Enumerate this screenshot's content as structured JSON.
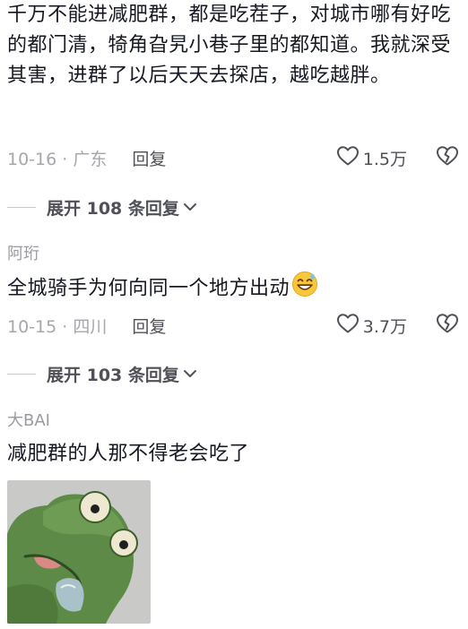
{
  "comments": [
    {
      "username": "",
      "content": "千万不能进减肥群，都是吃茬子，对城市哪有好吃的都门清，犄角旮旯小巷子里的都知道。我就深受其害，进群了以后天天去探店，越吃越胖。",
      "date_location": "10-16 · 广东",
      "reply_label": "回复",
      "like_count": "1.5万",
      "expand_label": "展开 108 条回复"
    },
    {
      "username": "阿珩",
      "content": "全城骑手为何向同一个地方出动",
      "emoji": "grinning-sweat-emoji",
      "date_location": "10-15 · 四川",
      "reply_label": "回复",
      "like_count": "3.7万",
      "expand_label": "展开 103 条回复"
    },
    {
      "username": "大BAI",
      "content": "减肥群的人那不得老会吃了",
      "image": "frog-sticker"
    }
  ],
  "icons": {
    "like": "heart-outline-icon",
    "dislike": "broken-heart-icon",
    "expand": "chevron-down-icon"
  },
  "colors": {
    "text_primary": "#161823",
    "text_secondary": "#a6a6ac",
    "text_action": "#505058"
  }
}
